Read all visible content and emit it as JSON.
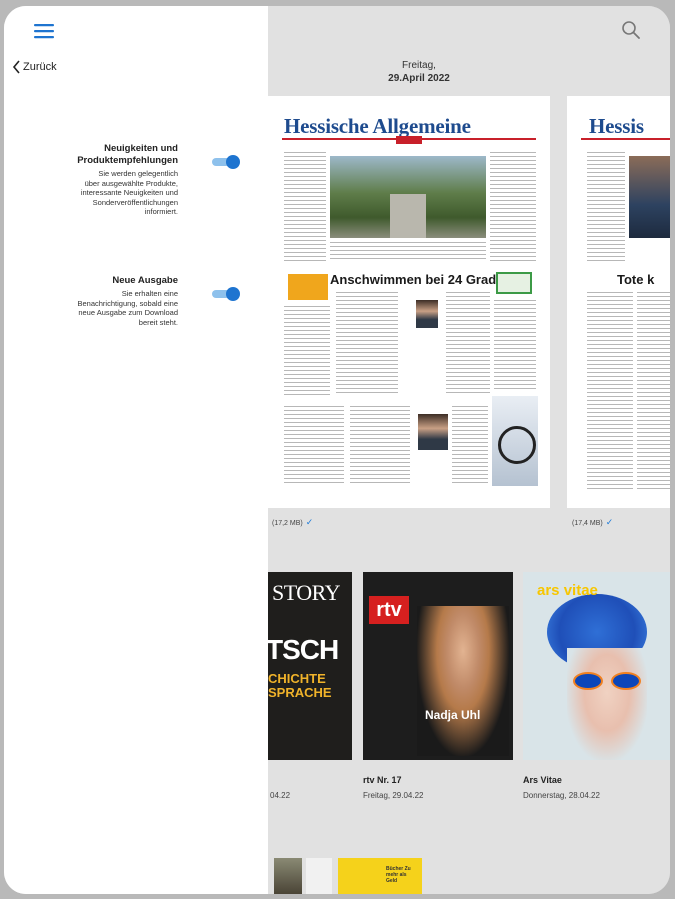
{
  "main": {
    "header": {
      "weekday": "Freitag,",
      "date": "29.April 2022"
    },
    "newspapers": [
      {
        "masthead": "Hessische Allgemeine",
        "headline": "Anschwimmen bei 24 Grad",
        "size": "(17,2 MB)"
      },
      {
        "masthead": "Hessis",
        "headline": "Tote k",
        "size": "(17,4 MB)"
      }
    ],
    "magazines": [
      {
        "cover_title": "STORY",
        "cover_big": "TSCH",
        "cover_sub": "CHICHTE SPRACHE",
        "title": "",
        "date": "04.22"
      },
      {
        "cover_logo": "rtv",
        "cover_name": "Nadja Uhl",
        "title": "rtv Nr. 17",
        "date": "Freitag, 29.04.22"
      },
      {
        "cover_brand": "ars vitae",
        "title": "Ars Vitae",
        "date": "Donnerstag, 28.04.22"
      }
    ],
    "bottom_thumb_text": "Bücher Zu mehr als Geld"
  },
  "drawer": {
    "back_label": "Zurück",
    "settings": [
      {
        "title_line1": "Neuigkeiten und",
        "title_line2": "Produktempfehlungen",
        "desc_lines": [
          "Sie werden gelegentlich",
          "über ausgewählte Produkte,",
          "interessante Neuigkeiten und",
          "Sonderveröffentlichungen",
          "informiert."
        ],
        "enabled": true
      },
      {
        "title_line1": "Neue Ausgabe",
        "desc_lines": [
          "Sie erhalten eine",
          "Benachrichtigung, sobald eine",
          "neue Ausgabe zum Download",
          "bereit steht."
        ],
        "enabled": true
      }
    ]
  },
  "colors": {
    "accent": "#1e74d0",
    "toggle_track": "#8ec1ec",
    "masthead": "#1e4b8e"
  },
  "icons": [
    "menu-icon",
    "search-icon",
    "chevron-left-icon",
    "checkmark-icon"
  ]
}
